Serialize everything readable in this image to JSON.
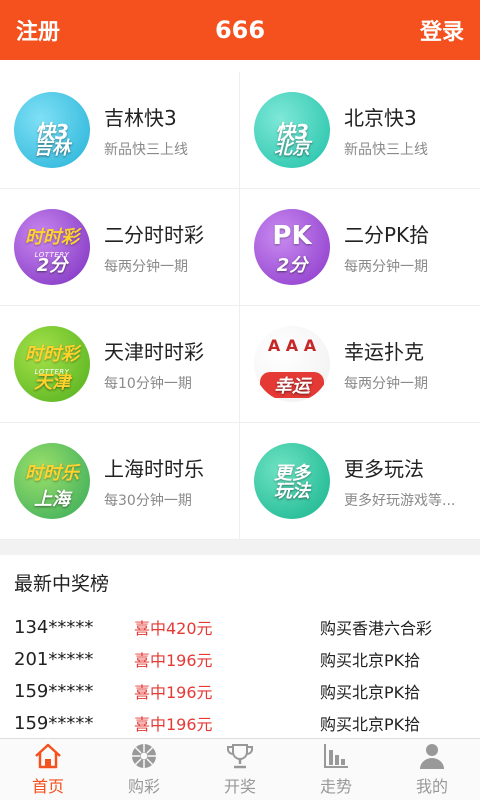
{
  "header": {
    "left_action": "注册",
    "title": "666",
    "right_action": "登录"
  },
  "colors": {
    "brand": "#f5511e",
    "prize_red": "#e53935",
    "tab_inactive": "#999999"
  },
  "games": [
    {
      "name": "吉林快3",
      "desc": "新品快三上线",
      "logo_main": "快3",
      "logo_sub": "吉林",
      "icon": "jilin-k3-logo-icon"
    },
    {
      "name": "北京快3",
      "desc": "新品快三上线",
      "logo_main": "快3",
      "logo_sub": "北京",
      "icon": "beijing-k3-logo-icon"
    },
    {
      "name": "二分时时彩",
      "desc": "每两分钟一期",
      "logo_main": "时时彩",
      "logo_tag": "LOTTERY",
      "logo_sub": "2分",
      "icon": "ssc-2min-logo-icon"
    },
    {
      "name": "二分PK拾",
      "desc": "每两分钟一期",
      "logo_main": "PK",
      "logo_sub": "2分",
      "icon": "pk10-2min-logo-icon"
    },
    {
      "name": "天津时时彩",
      "desc": "每10分钟一期",
      "logo_main": "时时彩",
      "logo_tag": "LOTTERY",
      "logo_sub": "天津",
      "icon": "tianjin-ssc-logo-icon"
    },
    {
      "name": "幸运扑克",
      "desc": "每两分钟一期",
      "logo_main": "A A A",
      "logo_sub": "幸运",
      "icon": "lucky-poker-logo-icon"
    },
    {
      "name": "上海时时乐",
      "desc": "每30分钟一期",
      "logo_main": "时时乐",
      "logo_sub": "上海",
      "icon": "shanghai-ssl-logo-icon"
    },
    {
      "name": "更多玩法",
      "desc": "更多好玩游戏等...",
      "logo_main": "更多",
      "logo_sub": "玩法",
      "icon": "more-games-logo-icon"
    }
  ],
  "winners": {
    "title": "最新中奖榜",
    "rows": [
      {
        "user": "134*****",
        "prize": "喜中420元",
        "game": "购买香港六合彩"
      },
      {
        "user": "201*****",
        "prize": "喜中196元",
        "game": "购买北京PK拾"
      },
      {
        "user": "159*****",
        "prize": "喜中196元",
        "game": "购买北京PK拾"
      },
      {
        "user": "159*****",
        "prize": "喜中196元",
        "game": "购买北京PK拾"
      }
    ]
  },
  "tabs": [
    {
      "label": "首页",
      "icon": "home-icon",
      "active": true
    },
    {
      "label": "购彩",
      "icon": "wheel-icon",
      "active": false
    },
    {
      "label": "开奖",
      "icon": "trophy-icon",
      "active": false
    },
    {
      "label": "走势",
      "icon": "bar-chart-icon",
      "active": false
    },
    {
      "label": "我的",
      "icon": "user-icon",
      "active": false
    }
  ]
}
